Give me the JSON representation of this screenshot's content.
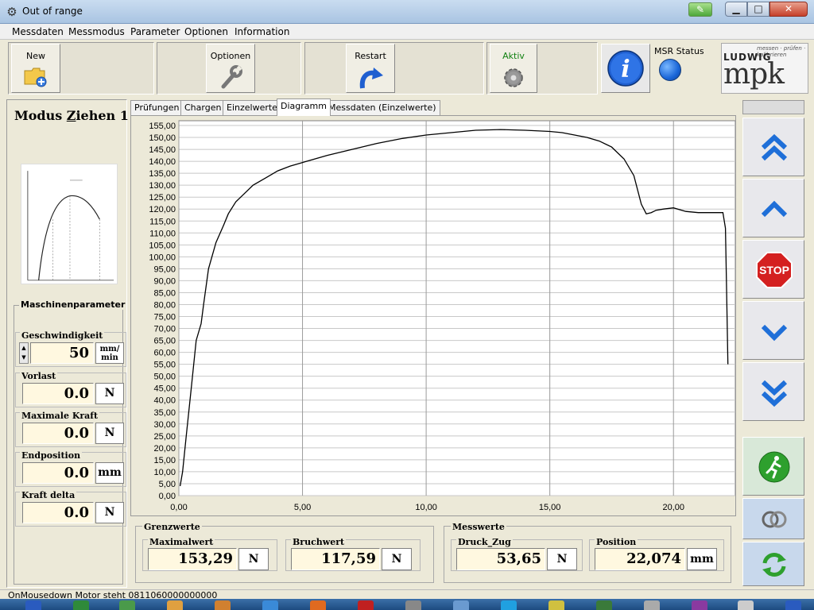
{
  "window": {
    "title": "Out of range",
    "app_icon": "gear-icon"
  },
  "menu": [
    "Messdaten",
    "Messmodus",
    "Parameter",
    "Optionen",
    "Information"
  ],
  "toolbar": {
    "new_label": "New",
    "optionen_label": "Optionen",
    "restart_label": "Restart",
    "aktiv_label": "Aktiv",
    "msr_status_label": "MSR Status",
    "logo_text": "LUDWIG",
    "logo_mark": "mpk",
    "logo_tagline": "messen · prüfen · kalibrieren"
  },
  "left": {
    "modus_prefix": "Modus ",
    "modus_underlined": "Z",
    "modus_rest": "iehen 1",
    "group_title": "Maschinenparameter",
    "fields": [
      {
        "label": "Geschwindigkeit",
        "value": "50",
        "unit_line1": "mm/",
        "unit_line2": "min"
      },
      {
        "label": "Vorlast",
        "value": "0.0",
        "unit": "N"
      },
      {
        "label": "Maximale Kraft",
        "value": "0.0",
        "unit": "N"
      },
      {
        "label": "Endposition",
        "value": "0.0",
        "unit": "mm"
      },
      {
        "label": "Kraft delta",
        "value": "0.0",
        "unit": "N"
      }
    ]
  },
  "tabs": [
    {
      "label": "Prüfungen",
      "active": false
    },
    {
      "label": "Chargen",
      "active": false
    },
    {
      "label": "Einzelwerte",
      "active": false
    },
    {
      "label": "Diagramm",
      "active": true
    },
    {
      "label": "Messdaten (Einzelwerte)",
      "active": false
    }
  ],
  "bottom": {
    "grenzwerte_title": "Grenzwerte",
    "messwerte_title": "Messwerte",
    "maximalwert_label": "Maximalwert",
    "maximalwert_value": "153,29",
    "maximalwert_unit": "N",
    "bruchwert_label": "Bruchwert",
    "bruchwert_value": "117,59",
    "bruchwert_unit": "N",
    "druck_zug_label": "Druck_Zug",
    "druck_zug_value": "53,65",
    "druck_zug_unit": "N",
    "position_label": "Position",
    "position_value": "22,074",
    "position_unit": "mm"
  },
  "right_nav": [
    "double-chevron-up-icon",
    "chevron-up-icon",
    "stop-sign-icon",
    "chevron-down-icon",
    "double-chevron-down-icon",
    "running-man-icon",
    "rings-icon",
    "refresh-icon"
  ],
  "status": {
    "text": "OnMousedown Motor steht 0811060000000000"
  },
  "colors": {
    "accent_blue": "#1f5fd0",
    "stop_red": "#d42020",
    "go_green": "#2ea02e",
    "field_bg": "#fff8e0"
  },
  "chart_data": {
    "type": "line",
    "xlim": [
      0,
      22.5
    ],
    "ylim": [
      0,
      157
    ],
    "x_ticks": [
      "0,00",
      "5,00",
      "10,00",
      "15,00",
      "20,00"
    ],
    "x_tick_values": [
      0,
      5,
      10,
      15,
      20
    ],
    "y_ticks": [
      "0,00",
      "5,00",
      "10,00",
      "15,00",
      "20,00",
      "25,00",
      "30,00",
      "35,00",
      "40,00",
      "45,00",
      "50,00",
      "55,00",
      "60,00",
      "65,00",
      "70,00",
      "75,00",
      "80,00",
      "85,00",
      "90,00",
      "95,00",
      "100,00",
      "105,00",
      "110,00",
      "115,00",
      "120,00",
      "125,00",
      "130,00",
      "135,00",
      "140,00",
      "145,00",
      "150,00",
      "155,00"
    ],
    "y_tick_values": [
      0,
      5,
      10,
      15,
      20,
      25,
      30,
      35,
      40,
      45,
      50,
      55,
      60,
      65,
      70,
      75,
      80,
      85,
      90,
      95,
      100,
      105,
      110,
      115,
      120,
      125,
      130,
      135,
      140,
      145,
      150,
      155
    ],
    "grid": true,
    "series": [
      {
        "x": [
          0.05,
          0.15,
          0.3,
          0.5,
          0.7,
          0.9,
          1.0,
          1.2,
          1.5,
          1.8,
          2.0,
          2.3,
          2.6,
          3.0,
          3.5,
          4.0,
          4.5,
          5.0,
          6.0,
          7.0,
          8.0,
          9.0,
          10.0,
          11.0,
          12.0,
          13.0,
          14.0,
          15.0,
          15.5,
          16.0,
          16.5,
          17.0,
          17.5,
          18.0,
          18.4,
          18.7,
          18.9,
          19.1,
          19.3,
          19.6,
          20.0,
          20.5,
          21.0,
          21.5,
          22.0,
          22.1,
          22.15,
          22.2
        ],
        "y": [
          4,
          10,
          25,
          45,
          65,
          72,
          80,
          95,
          106,
          113,
          118,
          123,
          126,
          130,
          133,
          136,
          138,
          139.5,
          142.5,
          145,
          147.5,
          149.5,
          151,
          152,
          153,
          153.3,
          153,
          152.5,
          152,
          151,
          150,
          148.5,
          146,
          141,
          134,
          122,
          118,
          118.5,
          119.5,
          120,
          120.5,
          119,
          118.5,
          118.5,
          118.5,
          112,
          85,
          55
        ]
      }
    ]
  }
}
